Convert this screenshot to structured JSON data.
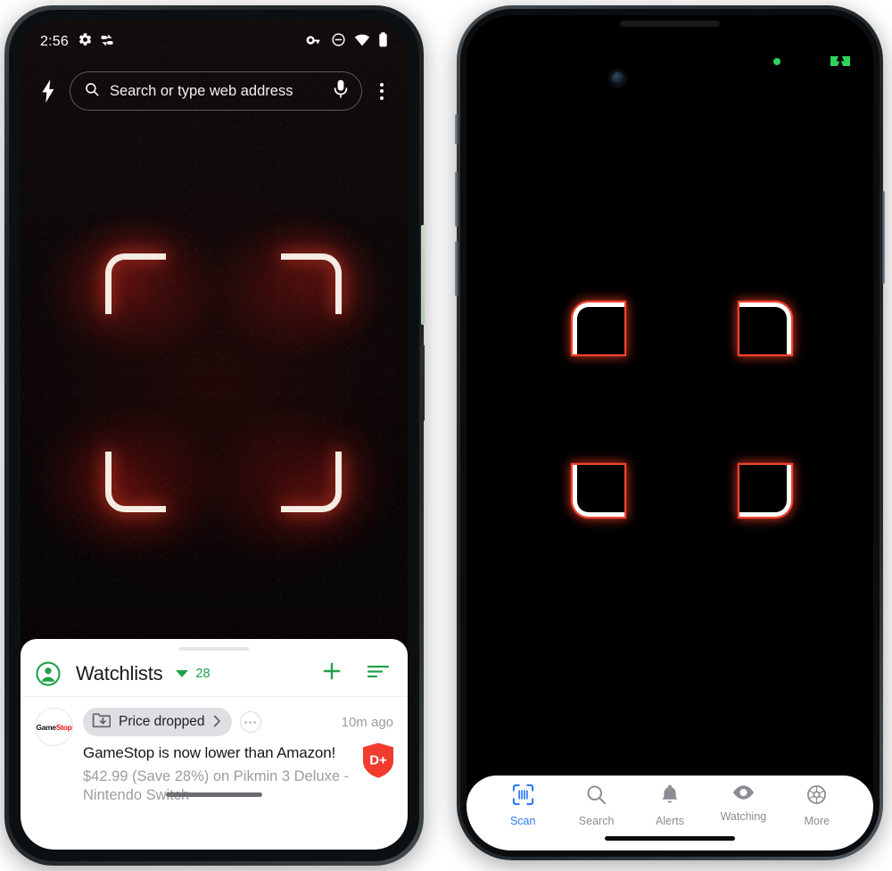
{
  "android": {
    "status_bar": {
      "clock": "2:56",
      "icons_left": [
        "gear-icon",
        "data-saver-icon"
      ],
      "icons_right": [
        "vpn-key-icon",
        "do-not-disturb-icon",
        "wifi-icon",
        "battery-icon"
      ]
    },
    "browser": {
      "flash_icon": "lightning-bolt-icon",
      "omnibox_placeholder": "Search or type web address",
      "search_icon": "search-icon",
      "mic_icon": "microphone-icon",
      "overflow_icon": "three-dots-vertical-icon"
    },
    "scanner": {
      "frame_label": "barcode-scan-frame",
      "corner_color": "#f4ebe2",
      "glow_color": "#b4231a"
    },
    "sheet": {
      "grab_handle": "drag-handle",
      "account_icon": "account-circle-icon",
      "title": "Watchlists",
      "dropdown_icon": "chevron-down-icon",
      "count": "28",
      "add_icon": "plus-icon",
      "sort_icon": "sort-filter-icon",
      "accent_color": "#21a14b",
      "item": {
        "retailer_logo_part1": "Game",
        "retailer_logo_part2": "Stop",
        "chip_icon": "folder-download-icon",
        "chip_label": "Price dropped",
        "chip_chevron": "chevron-right-icon",
        "more_icon": "three-dots-horizontal-icon",
        "timestamp": "10m ago",
        "headline": "GameStop is now lower than Amazon!",
        "subline": "$42.99 (Save 28%) on Pikmin 3 Deluxe - Nintendo Switch",
        "badge_label": "D+",
        "badge_icon": "shield-icon",
        "badge_color": "#f03b2e"
      }
    }
  },
  "ios": {
    "status": {
      "camera_icon": "front-camera-icon",
      "privacy_dot": "green-privacy-dot",
      "battery_icon": "battery-charging-icon",
      "battery_color": "#2fd45c"
    },
    "scanner": {
      "frame_label": "barcode-scan-frame",
      "corner_color": "#ffffff",
      "glow_color": "#f0442e"
    },
    "tabs": [
      {
        "label": "Scan",
        "icon": "barcode-scan-icon",
        "active": true
      },
      {
        "label": "Search",
        "icon": "search-icon",
        "active": false
      },
      {
        "label": "Alerts",
        "icon": "bell-icon",
        "active": false
      },
      {
        "label": "Watching",
        "icon": "eye-icon",
        "active": false
      },
      {
        "label": "More",
        "icon": "gear-icon",
        "active": false
      }
    ],
    "active_color": "#2f7cf6",
    "inactive_color": "#8a8d91"
  }
}
